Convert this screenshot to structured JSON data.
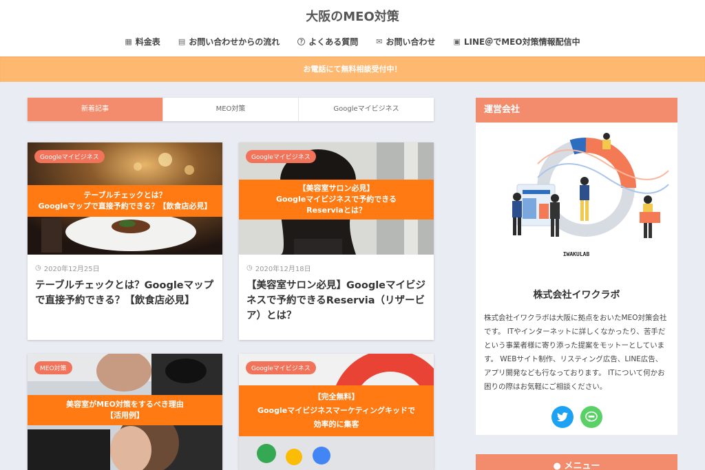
{
  "site": {
    "title": "大阪のMEO対策"
  },
  "nav": [
    {
      "icon": "calculator-icon",
      "glyph": "▦",
      "label": "料金表"
    },
    {
      "icon": "form-icon",
      "glyph": "▤",
      "label": "お問い合わせからの流れ"
    },
    {
      "icon": "question-icon",
      "glyph": "?",
      "label": "よくある質問"
    },
    {
      "icon": "mail-icon",
      "glyph": "✉",
      "label": "お問い合わせ"
    },
    {
      "icon": "line-icon",
      "glyph": "▣",
      "label": "LINE＠でMEO対策情報配信中"
    }
  ],
  "notice": {
    "text": "お電話にて無料相談受付中！"
  },
  "tabs": [
    "新着記事",
    "MEO対策",
    "Googleマイビジネス"
  ],
  "cards": [
    {
      "category": "Googleマイビジネス",
      "banner_lines": [
        "テーブルチェックとは？",
        "Googleマップで直接予約できる？【飲食店必見】"
      ],
      "date": "2020年12月25日",
      "title": "テーブルチェックとは？Googleマップで直接予約できる？【飲食店必見】"
    },
    {
      "category": "Googleマイビジネス",
      "banner_lines": [
        "【美容室サロン必見】",
        "Googleマイビジネスで予約できる",
        "Reserviaとは？"
      ],
      "date": "2020年12月18日",
      "title": "【美容室サロン必見】Googleマイビジネスで予約できるReservia（リザービア）とは？"
    },
    {
      "category": "MEO対策",
      "banner_lines": [
        "美容室がMEO対策をするべき理由",
        "【活用例】"
      ]
    },
    {
      "category": "Googleマイビジネス",
      "banner_lines": [
        "【完全無料】",
        "Googleマイビジネスマーケティングキッドで",
        "効率的に集客"
      ]
    }
  ],
  "sidebar": {
    "heading": "運営会社",
    "illustration_caption": "IWAKULAB",
    "company_name": "株式会社イワクラボ",
    "description": "株式会社イワクラボは大阪に拠点をおいたMEO対策会社です。 ITやインターネットに詳しくなかったり、苦手だという事業者様に寄り添った提案をモットーとしています。 WEBサイト制作、リスティング広告、LINE広告、アプリ開発なども行なっております。 ITについて何かお困りの際はお気軽にご相談ください。",
    "socials": [
      {
        "icon": "twitter-icon"
      },
      {
        "icon": "line-icon"
      }
    ]
  },
  "menu": {
    "heading": "メニュー",
    "icon": "pin-icon"
  },
  "colors": {
    "accent": "#f28c6d",
    "banner": "#ff7a12",
    "notice": "#ffb870",
    "background": "#e9ecf2"
  }
}
